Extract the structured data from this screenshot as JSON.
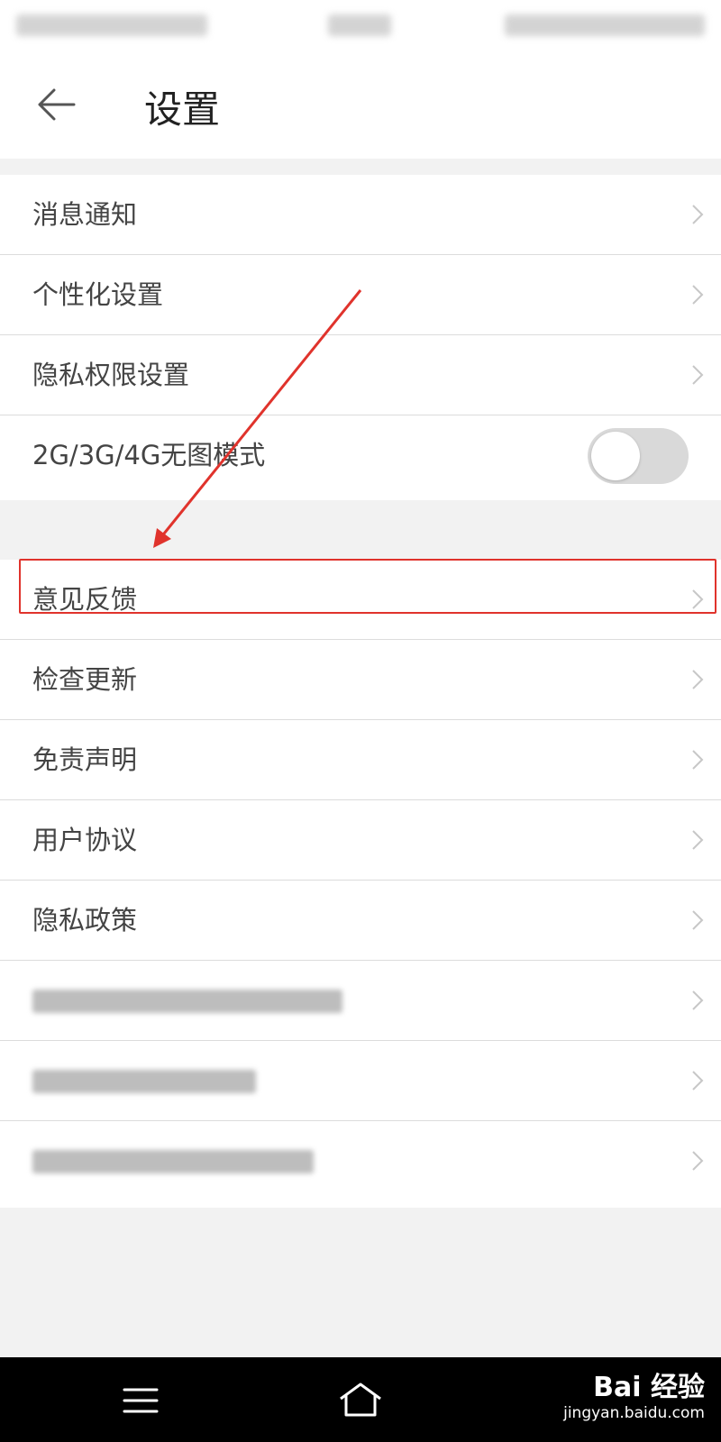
{
  "header": {
    "title": "设置"
  },
  "groups": {
    "first": [
      "消息通知",
      "个性化设置",
      "隐私权限设置"
    ],
    "toggle_row": {
      "label": "2G/3G/4G无图模式",
      "on": false
    },
    "second": [
      "意见反馈",
      "检查更新",
      "免责声明",
      "用户协议",
      "隐私政策"
    ]
  },
  "watermark": {
    "main": "Bai 经验",
    "sub": "jingyan.baidu.com"
  },
  "colors": {
    "highlight": "#e0332c",
    "toggle_off": "#d9d9d9"
  },
  "icons": [
    "back-arrow-icon",
    "chevron-right-icon",
    "menu-icon",
    "home-icon",
    "paw-icon"
  ]
}
